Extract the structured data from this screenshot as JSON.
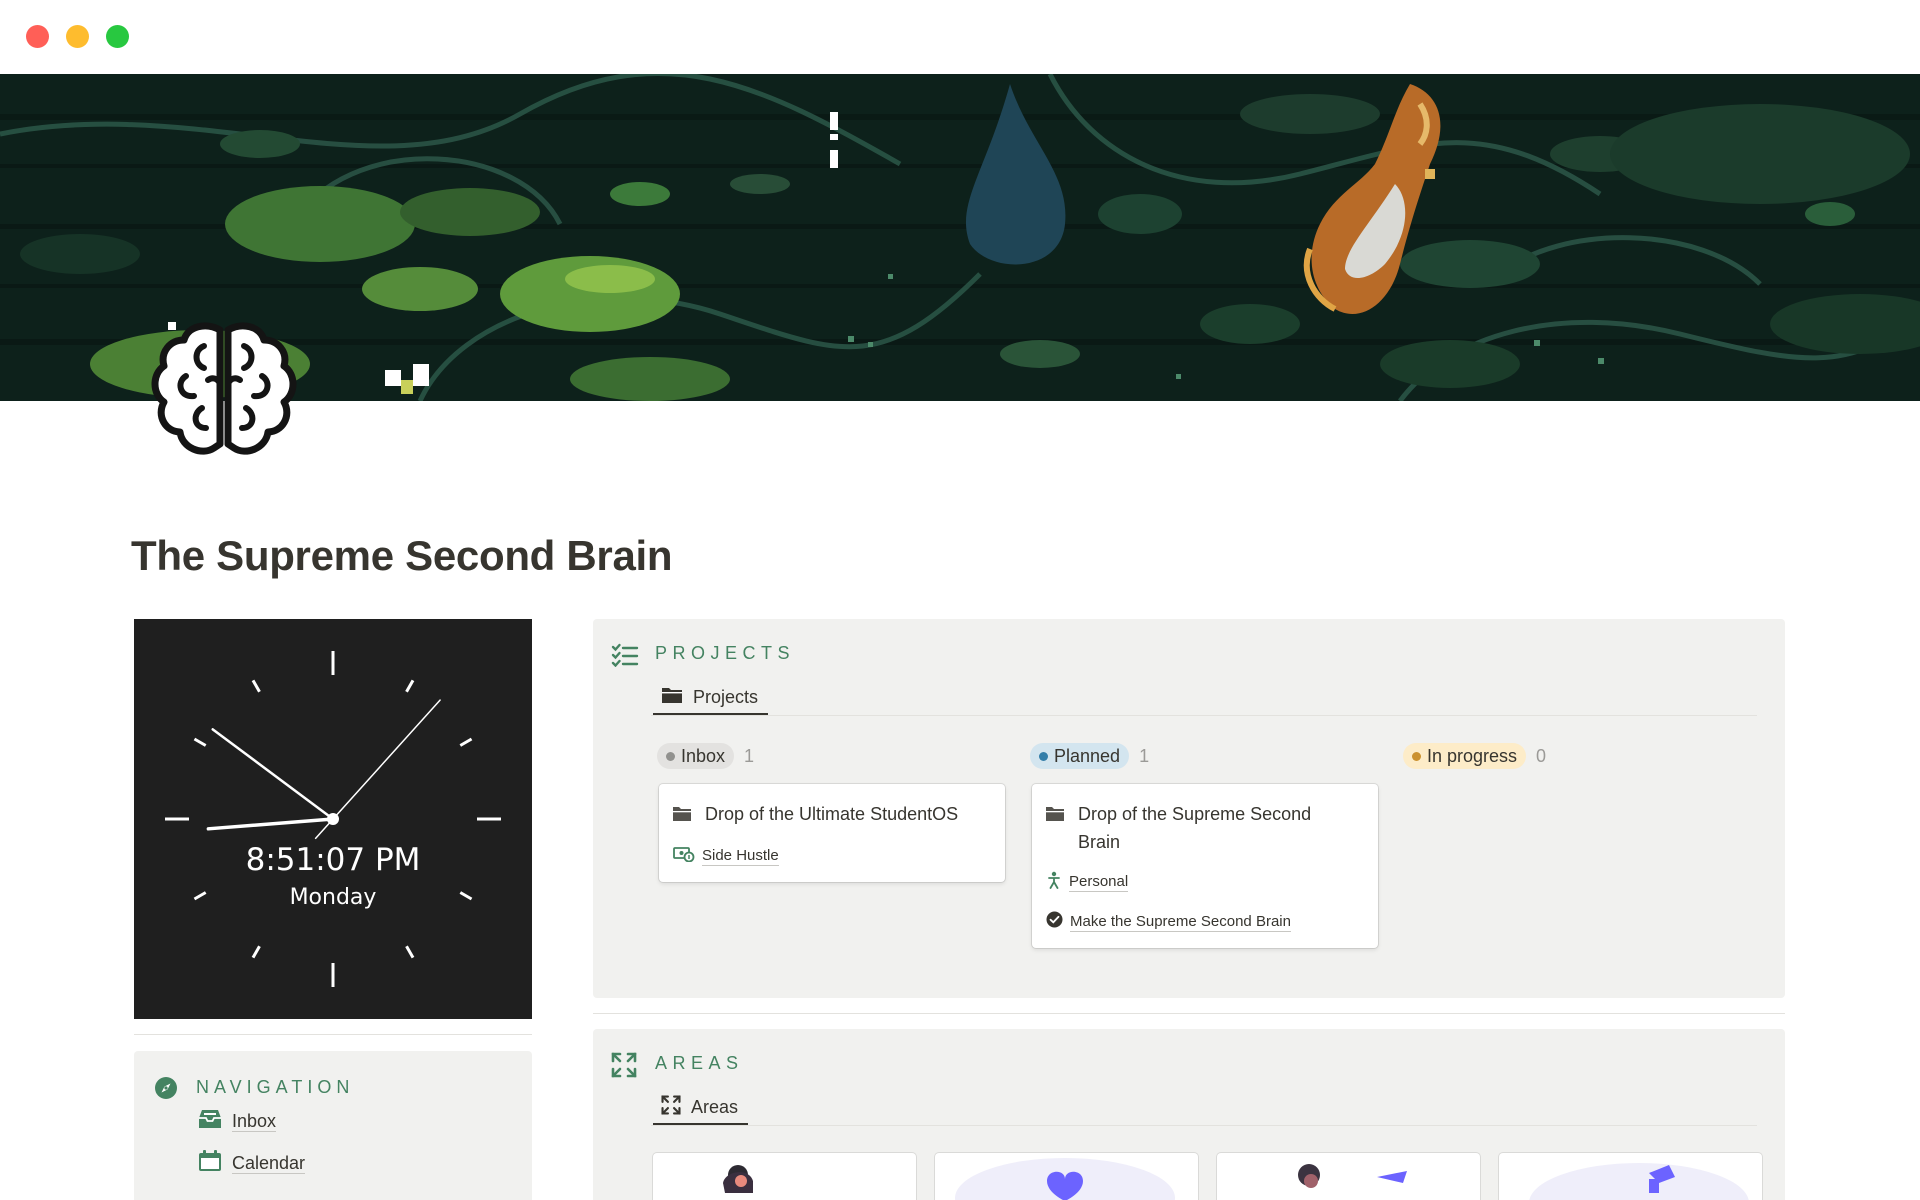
{
  "window": {
    "controls": [
      "close",
      "minimize",
      "zoom"
    ]
  },
  "page": {
    "title": "The Supreme Second Brain",
    "icon": "brain-icon",
    "cover": "pixel-art koi pond cover image"
  },
  "clock": {
    "time": "8:51:07 PM",
    "day": "Monday",
    "hour": 8,
    "minute": 51,
    "second": 7
  },
  "navigation": {
    "heading": "NAVIGATION",
    "items": [
      {
        "label": "Inbox",
        "icon": "inbox-tray-icon"
      },
      {
        "label": "Calendar",
        "icon": "calendar-icon"
      }
    ]
  },
  "projects": {
    "heading": "PROJECTS",
    "view_label": "Projects",
    "groups": [
      {
        "label": "Inbox",
        "count": "1",
        "dot_color": "#91918e",
        "bg": "#e3e2e0"
      },
      {
        "label": "Planned",
        "count": "1",
        "dot_color": "#337ea9",
        "bg": "#d3e5ef"
      },
      {
        "label": "In progress",
        "count": "0",
        "dot_color": "#cb912f",
        "bg": "#fdecc8"
      }
    ],
    "cards": [
      {
        "title": "Drop of the Ultimate StudentOS",
        "props": [
          "Side Hustle"
        ]
      },
      {
        "title": "Drop of the Supreme Second Brain",
        "props": [
          "Personal",
          "Make the Supreme Second Brain"
        ]
      }
    ]
  },
  "areas": {
    "heading": "AREAS",
    "view_label": "Areas"
  },
  "colors": {
    "accent_green": "#448361",
    "panel_bg": "#f1f1ef",
    "text": "#37352f",
    "clock_bg": "#1f1f1f"
  }
}
